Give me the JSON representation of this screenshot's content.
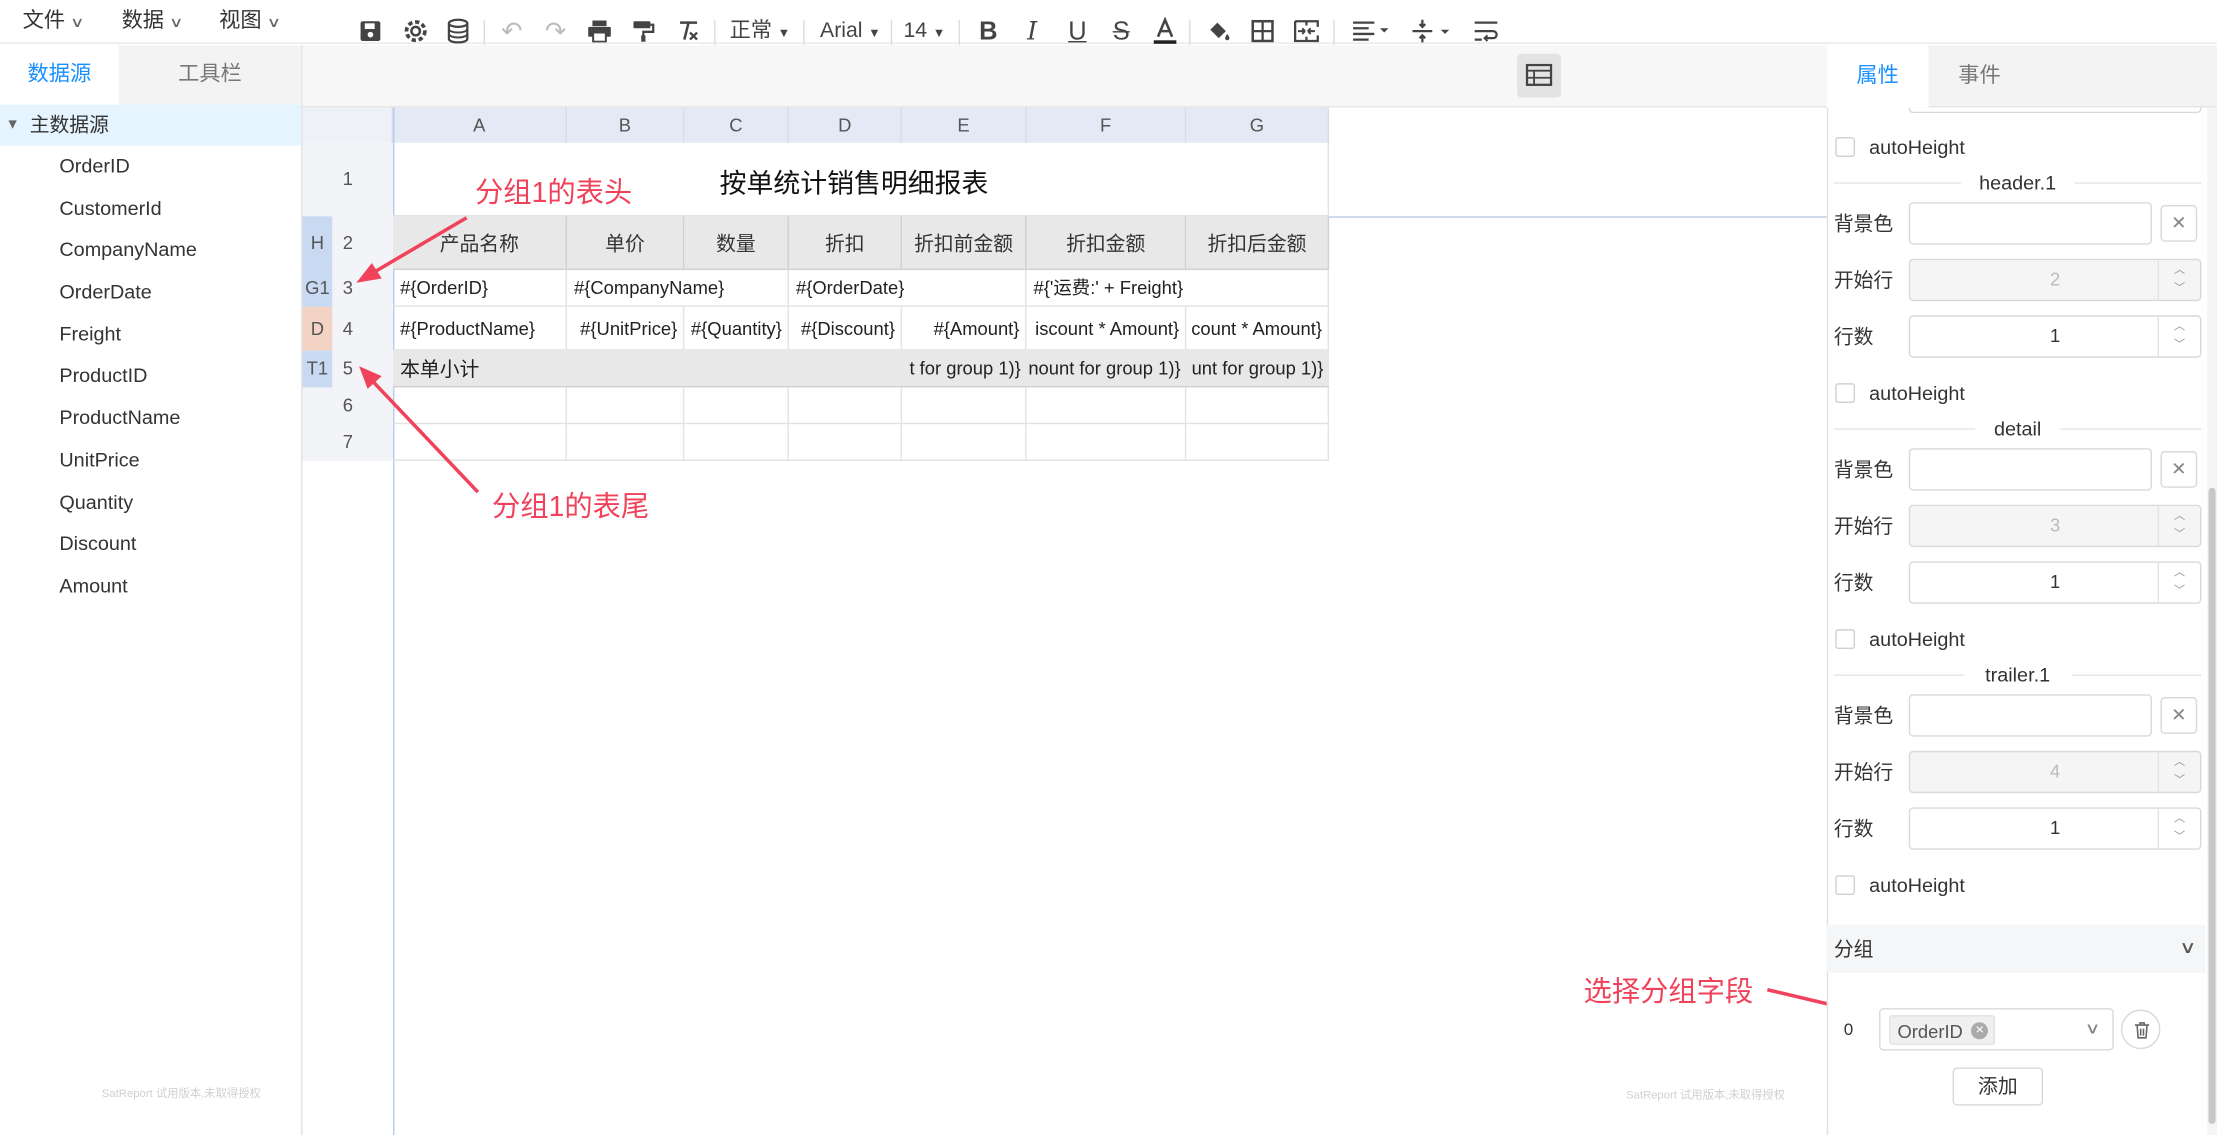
{
  "menu": {
    "file": "文件",
    "data": "数据",
    "view": "视图"
  },
  "left": {
    "tabs": [
      "数据源",
      "工具栏"
    ],
    "root": "主数据源",
    "fields": [
      "OrderID",
      "CustomerId",
      "CompanyName",
      "OrderDate",
      "Freight",
      "ProductID",
      "ProductName",
      "UnitPrice",
      "Quantity",
      "Discount",
      "Amount"
    ],
    "watermark": "SatReport 试用版本,未取得授权"
  },
  "toolbar": {
    "format": "正常",
    "font": "Arial",
    "size": "14"
  },
  "grid": {
    "columns": [
      "A",
      "B",
      "C",
      "D",
      "E",
      "F",
      "G"
    ],
    "rows": [
      "1",
      "2",
      "3",
      "4",
      "5",
      "6",
      "7"
    ],
    "tags": {
      "r2": "H",
      "r3": "G1",
      "r4": "D",
      "r5": "T1"
    },
    "title": "按单统计销售明细报表",
    "headers": [
      "产品名称",
      "单价",
      "数量",
      "折扣",
      "折扣前金额",
      "折扣金额",
      "折扣后金额"
    ],
    "row3": {
      "a": "#{OrderID}",
      "b": "#{CompanyName}",
      "d": "#{OrderDate}",
      "f": "#{'运费:' + Freight}"
    },
    "row4": [
      "#{ProductName}",
      "#{UnitPrice}",
      "#{Quantity}",
      "#{Discount}",
      "#{Amount}",
      "iscount * Amount}",
      "count * Amount}"
    ],
    "row5": {
      "a": "本单小计",
      "e": "t for group 1)}",
      "f": "nount for group 1)}",
      "g": "unt for group 1)}"
    }
  },
  "annotations": {
    "header": "分组1的表头",
    "trailer": "分组1的表尾",
    "select": "选择分组字段"
  },
  "right": {
    "tabs": [
      "属性",
      "事件"
    ],
    "sections": {
      "header": "header.1",
      "detail": "detail",
      "trailer": "trailer.1"
    },
    "labels": {
      "bg": "背景色",
      "start": "开始行",
      "rows": "行数",
      "auto": "autoHeight"
    },
    "header_start": "2",
    "header_rows": "1",
    "detail_start": "3",
    "detail_rows": "1",
    "trailer_start": "4",
    "trailer_rows": "1",
    "group_title": "分组",
    "group_index": "0",
    "group_field": "OrderID",
    "add_button": "添加"
  }
}
